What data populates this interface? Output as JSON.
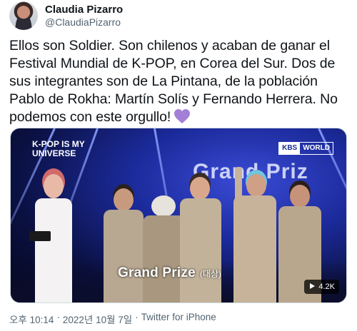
{
  "author": {
    "display_name": "Claudia Pizarro",
    "handle": "@ClaudiaPizarro"
  },
  "tweet": {
    "text": "Ellos son Soldier. Son chilenos y acaban de ganar el Festival Mundial de K-POP, en Corea del Sur. Dos de sus integrantes son de La Pintana, de la población Pablo de Rokha: Martín Solís y Fernando Herrera. No podemos con este orgullo!",
    "emoji": "purple-heart"
  },
  "media": {
    "show_logo_line1": "K-POP IS MY",
    "show_logo_line2": "UNIVERSE",
    "broadcaster_a": "KBS",
    "broadcaster_b": "WORLD",
    "backdrop_text": "Grand Priz",
    "caption_main": "Grand Prize",
    "caption_sub": "(대상)",
    "view_count": "4.2K"
  },
  "meta": {
    "time": "오후 10:14",
    "separator1": "·",
    "date": "2022년 10월 7일",
    "separator2": "·",
    "source": "Twitter for iPhone"
  },
  "colors": {
    "text": "#0f1419",
    "secondary": "#536471",
    "heart": "#a47fd6"
  }
}
